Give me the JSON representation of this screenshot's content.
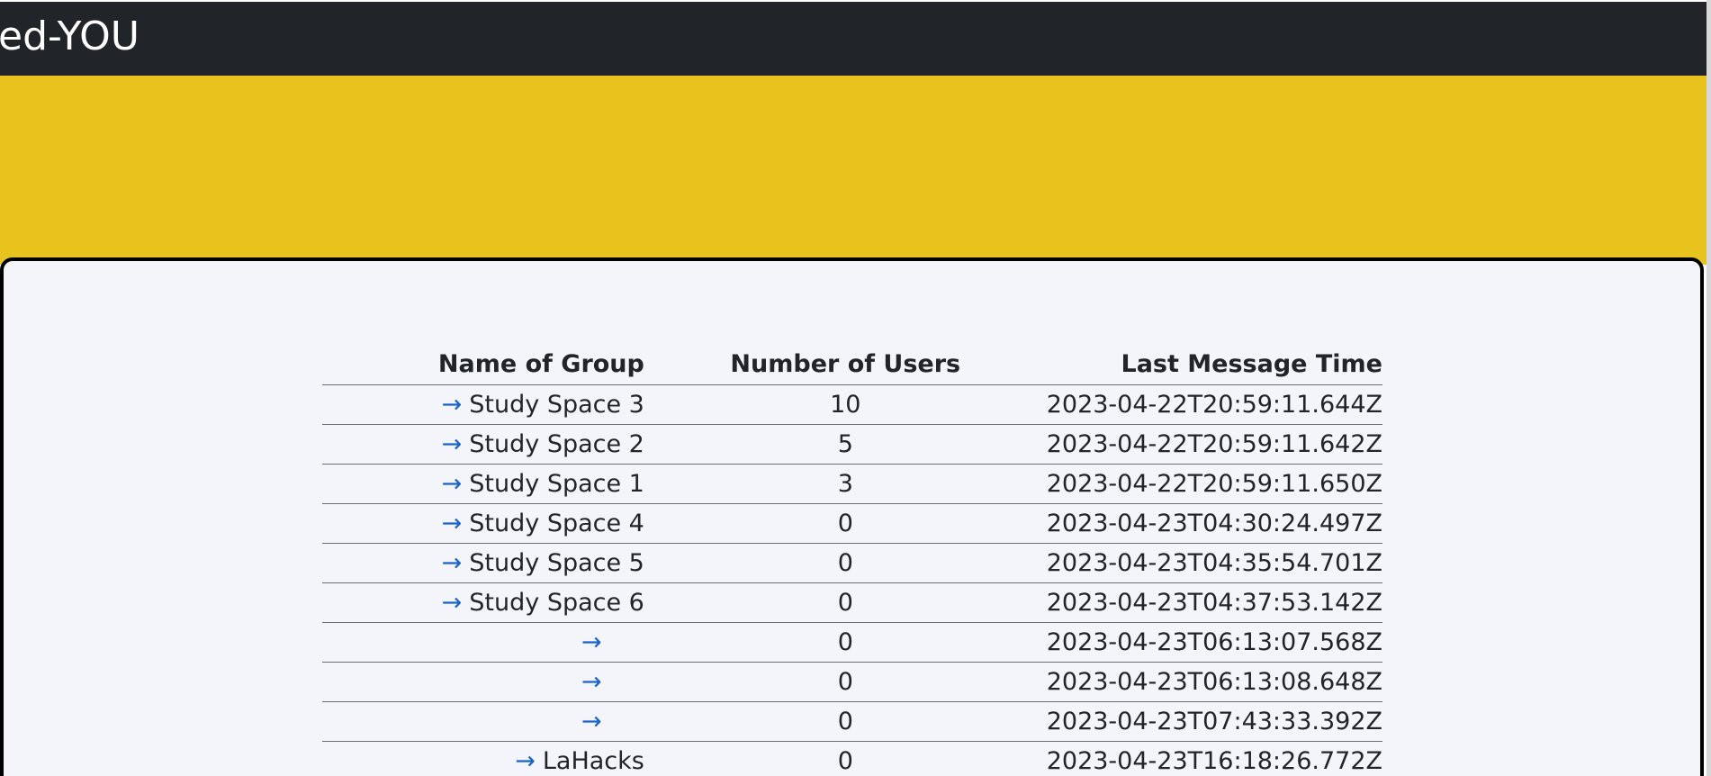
{
  "header": {
    "brand": "ed-YOU"
  },
  "colors": {
    "topbar": "#212429",
    "banner": "#e9c31d",
    "card_background": "#f4f5fa",
    "link_arrow": "#1a63c9"
  },
  "table": {
    "columns": [
      "Name of Group",
      "Number of Users",
      "Last Message Time"
    ],
    "rows": [
      {
        "arrow": "→",
        "name": "Study Space 3",
        "users": "10",
        "time": "2023-04-22T20:59:11.644Z"
      },
      {
        "arrow": "→",
        "name": "Study Space 2",
        "users": "5",
        "time": "2023-04-22T20:59:11.642Z"
      },
      {
        "arrow": "→",
        "name": "Study Space 1",
        "users": "3",
        "time": "2023-04-22T20:59:11.650Z"
      },
      {
        "arrow": "→",
        "name": "Study Space 4",
        "users": "0",
        "time": "2023-04-23T04:30:24.497Z"
      },
      {
        "arrow": "→",
        "name": "Study Space 5",
        "users": "0",
        "time": "2023-04-23T04:35:54.701Z"
      },
      {
        "arrow": "→",
        "name": "Study Space 6",
        "users": "0",
        "time": "2023-04-23T04:37:53.142Z"
      },
      {
        "arrow": "→",
        "name": "",
        "users": "0",
        "time": "2023-04-23T06:13:07.568Z"
      },
      {
        "arrow": "→",
        "name": "",
        "users": "0",
        "time": "2023-04-23T06:13:08.648Z"
      },
      {
        "arrow": "→",
        "name": "",
        "users": "0",
        "time": "2023-04-23T07:43:33.392Z"
      },
      {
        "arrow": "→",
        "name": "LaHacks",
        "users": "0",
        "time": "2023-04-23T16:18:26.772Z"
      }
    ]
  }
}
